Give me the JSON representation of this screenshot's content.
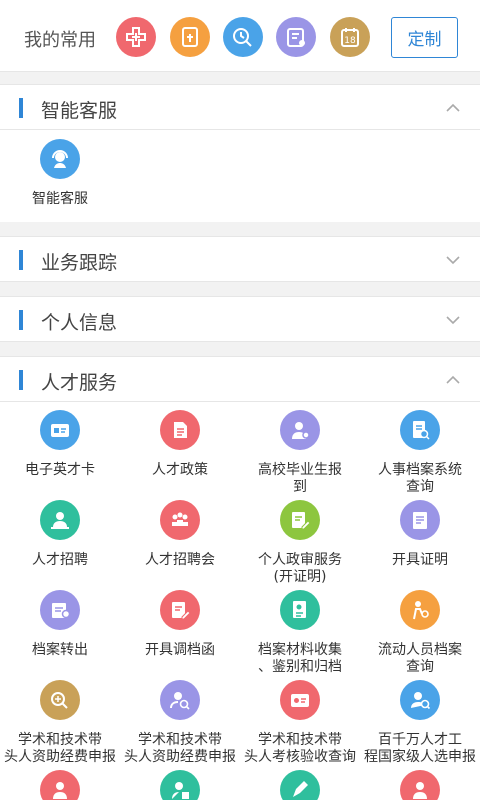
{
  "favorites": {
    "label": "我的常用",
    "icons": [
      {
        "name": "medical-cross-icon",
        "color": "#f0686e"
      },
      {
        "name": "document-icon",
        "color": "#f5a040"
      },
      {
        "name": "chart-search-icon",
        "color": "#4aa3e8"
      },
      {
        "name": "clipboard-icon",
        "color": "#9a95e6"
      },
      {
        "name": "calendar-icon",
        "color": "#c9a158",
        "text": "18"
      }
    ],
    "custom_button": "定制"
  },
  "sections": {
    "smart_service": {
      "title": "智能客服",
      "items": [
        {
          "label": "智能客服",
          "icon": "customer-service-icon",
          "color": "#4aa3e8"
        }
      ]
    },
    "business_tracking": {
      "title": "业务跟踪"
    },
    "personal_info": {
      "title": "个人信息"
    },
    "talent_service": {
      "title": "人才服务",
      "items": [
        {
          "label": "电子英才卡",
          "icon": "id-card-icon",
          "color": "#4aa3e8"
        },
        {
          "label": "人才政策",
          "icon": "policy-document-icon",
          "color": "#f0686e"
        },
        {
          "label": "高校毕业生报\n到",
          "icon": "graduate-icon",
          "color": "#9a95e6"
        },
        {
          "label": "人事档案系统\n查询",
          "icon": "archive-search-icon",
          "color": "#4aa3e8"
        },
        {
          "label": "人才招聘",
          "icon": "recruit-icon",
          "color": "#2fbf9d"
        },
        {
          "label": "人才招聘会",
          "icon": "job-fair-icon",
          "color": "#f0686e"
        },
        {
          "label": "个人政审服务\n(开证明)",
          "icon": "edit-document-icon",
          "color": "#8dc63f"
        },
        {
          "label": "开具证明",
          "icon": "certificate-icon",
          "color": "#9a95e6"
        },
        {
          "label": "档案转出",
          "icon": "archive-transfer-icon",
          "color": "#9a95e6"
        },
        {
          "label": "开具调档函",
          "icon": "letter-edit-icon",
          "color": "#f0686e"
        },
        {
          "label": "档案材料收集\n、鉴别和归档",
          "icon": "archive-material-icon",
          "color": "#2fbf9d"
        },
        {
          "label": "流动人员档案\n查询",
          "icon": "person-search-icon",
          "color": "#f5a040"
        },
        {
          "label": "学术和技术带\n头人资助经费申报",
          "icon": "funding-icon",
          "color": "#c9a158"
        },
        {
          "label": "学术和技术带\n头人资助经费申报",
          "icon": "user-search-icon",
          "color": "#9a95e6"
        },
        {
          "label": "学术和技术带\n头人考核验收查询",
          "icon": "assessment-card-icon",
          "color": "#f0686e"
        },
        {
          "label": "百千万人才工\n程国家级人选申报",
          "icon": "person-apply-icon",
          "color": "#4aa3e8"
        },
        {
          "label": "",
          "icon": "person-service-icon",
          "color": "#f0686e"
        },
        {
          "label": "",
          "icon": "person-document-icon",
          "color": "#2fbf9d"
        },
        {
          "label": "",
          "icon": "pen-icon",
          "color": "#2fbf9d"
        },
        {
          "label": "",
          "icon": "person-badge-icon",
          "color": "#f0686e"
        }
      ]
    }
  }
}
